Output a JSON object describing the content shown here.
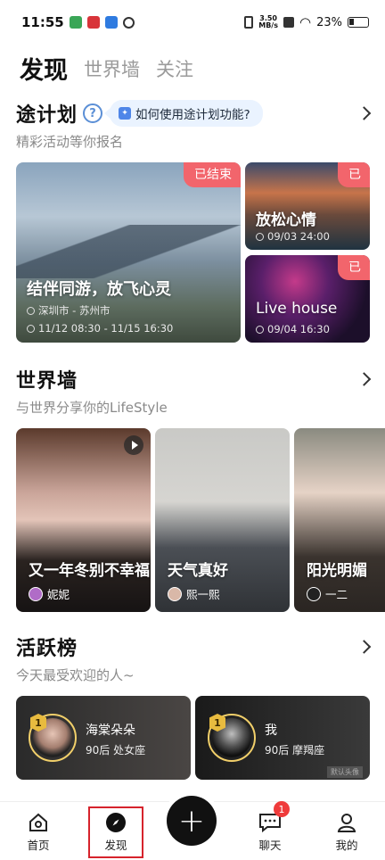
{
  "status_bar": {
    "time": "11:55",
    "net_speed_value": "3.50",
    "net_speed_unit": "MB/s",
    "battery": "23%"
  },
  "top_tabs": [
    "发现",
    "世界墙",
    "关注"
  ],
  "trip_plan": {
    "title": "途计划",
    "hint": "如何使用途计划功能?",
    "subtitle": "精彩活动等你报名",
    "cards": [
      {
        "title": "结伴同游，放飞心灵",
        "location": "深圳市 - 苏州市",
        "time": "11/12 08:30 - 11/15 16:30",
        "badge": "已结束"
      },
      {
        "title": "放松心情",
        "time": "09/03 24:00",
        "badge": "已"
      },
      {
        "title": "Live house",
        "time": "09/04 16:30",
        "badge": "已"
      }
    ]
  },
  "world_wall": {
    "title": "世界墙",
    "subtitle": "与世界分享你的LifeStyle",
    "posts": [
      {
        "title": "又一年冬别不幸福",
        "user": "妮妮"
      },
      {
        "title": "天气真好",
        "user": "熙一熙"
      },
      {
        "title": "阳光明媚",
        "user": "一二"
      }
    ]
  },
  "active_list": {
    "title": "活跃榜",
    "subtitle": "今天最受欢迎的人~",
    "users": [
      {
        "rank": "1",
        "name": "海棠朵朵",
        "meta": "90后 处女座"
      },
      {
        "rank": "1",
        "name": "我",
        "meta": "90后 摩羯座",
        "tag": "默认头像"
      }
    ]
  },
  "bottom_nav": {
    "items": [
      {
        "label": "首页"
      },
      {
        "label": "发现"
      },
      {
        "label": "聊天",
        "badge": "1"
      },
      {
        "label": "我的"
      }
    ],
    "fab": "+"
  }
}
